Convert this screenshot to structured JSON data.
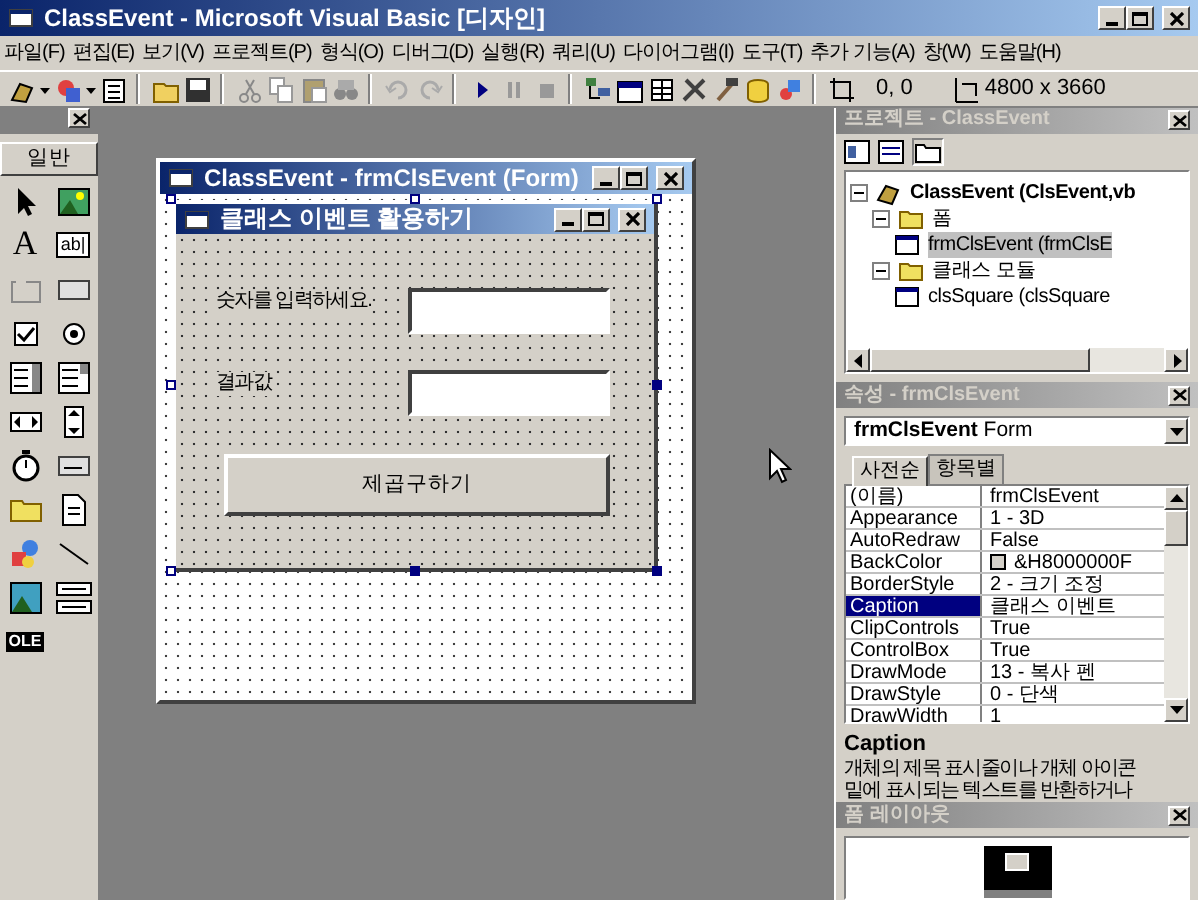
{
  "window": {
    "title": "ClassEvent - Microsoft Visual Basic [디자인]"
  },
  "menu": [
    "파일(F)",
    "편집(E)",
    "보기(V)",
    "프로젝트(P)",
    "형식(O)",
    "디버그(D)",
    "실행(R)",
    "쿼리(U)",
    "다이어그램(I)",
    "도구(T)",
    "추가 기능(A)",
    "창(W)",
    "도움말(H)"
  ],
  "toolbar": {
    "position": "0, 0",
    "size": "4800 x 3660"
  },
  "toolbox": {
    "tab": "일반",
    "label_glyph": "A",
    "textbox_glyph": "ab|",
    "ole_glyph": "OLE"
  },
  "form_designer": {
    "title": "ClassEvent - frmClsEvent (Form)",
    "form": {
      "title": "클래스 이벤트 활용하기",
      "labels": [
        "숫자를 입력하세요.",
        "결과값"
      ],
      "button": "제곱구하기"
    }
  },
  "project": {
    "title": "프로젝트 - ClassEvent",
    "tree": [
      {
        "label": "ClassEvent (ClsEvent,vb",
        "expanded": true,
        "selected": false,
        "children": [
          {
            "label": "폼",
            "expanded": true,
            "selected": false,
            "children": [
              {
                "label": "frmClsEvent (frmClsE",
                "selected": true
              }
            ]
          },
          {
            "label": "클래스 모듈",
            "expanded": true,
            "selected": false,
            "children": [
              {
                "label": "clsSquare (clsSquare",
                "selected": false
              }
            ]
          }
        ]
      }
    ]
  },
  "properties": {
    "title": "속성 - frmClsEvent",
    "object": "frmClsEvent",
    "object_type": "Form",
    "tabs": [
      {
        "label": "사전순",
        "selected": true
      },
      {
        "label": "항목별",
        "selected": false
      }
    ],
    "rows": [
      {
        "name": "(이름)",
        "value": "frmClsEvent",
        "selected": false
      },
      {
        "name": "Appearance",
        "value": "1 - 3D",
        "selected": false
      },
      {
        "name": "AutoRedraw",
        "value": "False",
        "selected": false
      },
      {
        "name": "BackColor",
        "value": "&H8000000F",
        "selected": false,
        "color": "#d4d0c8"
      },
      {
        "name": "BorderStyle",
        "value": "2 - 크기 조정",
        "selected": false
      },
      {
        "name": "Caption",
        "value": "클래스 이벤트",
        "selected": true
      },
      {
        "name": "ClipControls",
        "value": "True",
        "selected": false
      },
      {
        "name": "ControlBox",
        "value": "True",
        "selected": false
      },
      {
        "name": "DrawMode",
        "value": "13 - 복사 펜",
        "selected": false
      },
      {
        "name": "DrawStyle",
        "value": "0 - 단색",
        "selected": false
      },
      {
        "name": "DrawWidth",
        "value": "1",
        "selected": false
      }
    ],
    "description": {
      "title": "Caption",
      "lines": [
        "개체의 제목 표시줄이나 개체 아이콘",
        "밑에 표시되는 텍스트를 반환하거나"
      ]
    }
  },
  "form_layout": {
    "title": "폼 레이아웃"
  }
}
